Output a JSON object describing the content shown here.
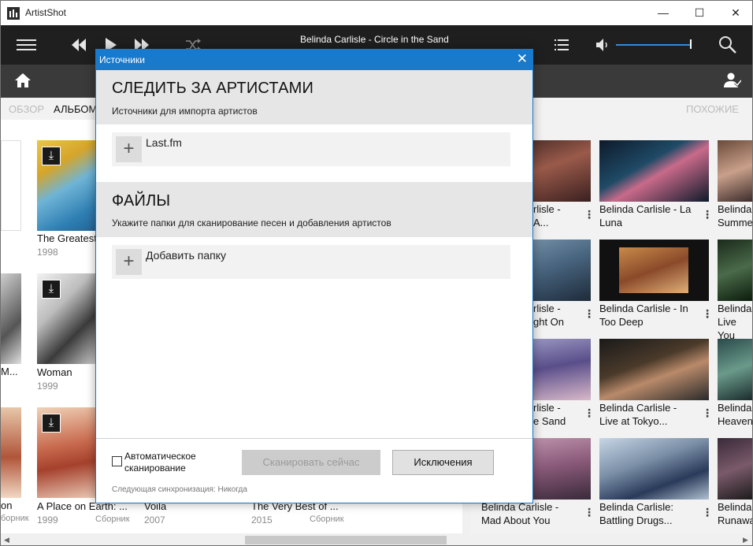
{
  "window": {
    "app_title": "ArtistShot",
    "minimize": "—",
    "maximize": "☐",
    "close": "✕"
  },
  "player": {
    "now_playing": "Belinda Carlisle - Circle in the Sand",
    "volume_level": 1.0
  },
  "tabs": {
    "overview": "ОБЗОР",
    "albums": "АЛЬБОМ",
    "similar": "ПОХОЖИЕ"
  },
  "albums": [
    {
      "title": "The Greatest",
      "year": "1998",
      "type": ""
    },
    {
      "title": "Woman",
      "year": "1999",
      "type": ""
    },
    {
      "title": "A Place on Earth: ...",
      "year": "1999",
      "type": "Сборник"
    },
    {
      "title": "Voila",
      "year": "2007",
      "type": ""
    },
    {
      "title": "The Very Best of ...",
      "year": "2015",
      "type": "Сборник"
    }
  ],
  "left_partial": {
    "title_m": "M...",
    "title_on": "on",
    "sub_bo": "борник"
  },
  "videos": {
    "col1": [
      {
        "title": "rlisle -\nA..."
      },
      {
        "title": "rlisle -\nght On"
      },
      {
        "title": "rlisle -\ne Sand"
      },
      {
        "title": "Belinda Carlisle -\nMad About You"
      }
    ],
    "col2": [
      {
        "title": "Belinda Carlisle - La Luna"
      },
      {
        "title": "Belinda Carlisle - In Too Deep"
      },
      {
        "title": "Belinda Carlisle - Live at Tokyo..."
      },
      {
        "title": "Belinda Carlisle: Battling Drugs..."
      }
    ],
    "col3": [
      {
        "title": "Belinda\nSumme"
      },
      {
        "title": "Belinda\nLive You"
      },
      {
        "title": "Belinda\nHeaven"
      },
      {
        "title": "Belinda\nRunawa"
      }
    ],
    "more": "⋮"
  },
  "dialog": {
    "title": "Источники",
    "close": "✕",
    "artists_section": {
      "heading": "СЛЕДИТЬ ЗА АРТИСТАМИ",
      "description": "Источники для импорта артистов",
      "item": "Last.fm"
    },
    "files_section": {
      "heading": "ФАЙЛЫ",
      "description": "Укажите папки для сканирование песен и добавления артистов",
      "item": "Добавить папку"
    },
    "plus": "+",
    "auto_scan_label": "Автоматическое сканирование",
    "auto_scan_checked": false,
    "scan_now": "Сканировать сейчас",
    "exclusions": "Исключения",
    "next_sync": "Следующая синхронизация: Никогда"
  },
  "colors": {
    "accent": "#1979ca",
    "player_bg": "#1f1f1f",
    "nav_bg": "#3a3a3a"
  }
}
